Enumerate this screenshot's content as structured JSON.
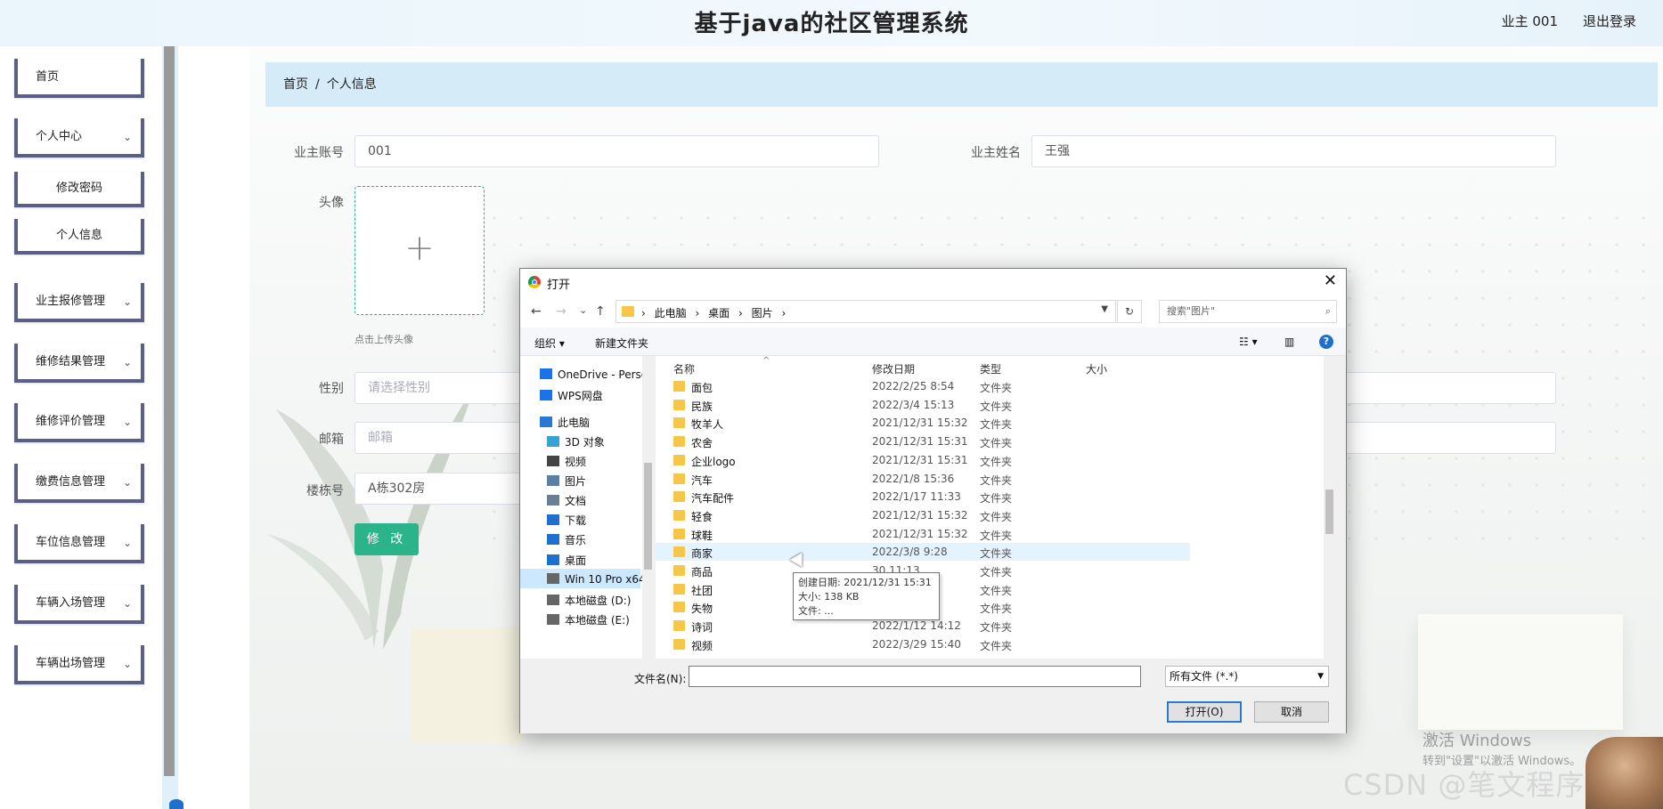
{
  "header": {
    "title": "基于java的社区管理系统",
    "user": "业主 001",
    "logout": "退出登录"
  },
  "sidebar": {
    "items": [
      {
        "label": "首页",
        "has_chevron": false
      },
      {
        "label": "个人中心",
        "has_chevron": true
      },
      {
        "label": "修改密码",
        "sub": true
      },
      {
        "label": "个人信息",
        "sub": true
      },
      {
        "label": "业主报修管理",
        "has_chevron": true
      },
      {
        "label": "维修结果管理",
        "has_chevron": true
      },
      {
        "label": "维修评价管理",
        "has_chevron": true
      },
      {
        "label": "缴费信息管理",
        "has_chevron": true
      },
      {
        "label": "车位信息管理",
        "has_chevron": true
      },
      {
        "label": "车辆入场管理",
        "has_chevron": true
      },
      {
        "label": "车辆出场管理",
        "has_chevron": true
      }
    ],
    "chevron": "⌄"
  },
  "breadcrumb": {
    "home": "首页",
    "sep": "/",
    "current": "个人信息"
  },
  "form": {
    "account_label": "业主账号",
    "account_value": "001",
    "name_label": "业主姓名",
    "name_value": "王强",
    "avatar_label": "头像",
    "avatar_hint": "点击上传头像",
    "avatar_plus": "+",
    "gender_label": "性别",
    "gender_placeholder": "请选择性别",
    "email_label": "邮箱",
    "email_placeholder": "邮箱",
    "building_label": "楼栋号",
    "building_value": "A栋302房",
    "submit_label": "修 改"
  },
  "dialog": {
    "title": "打开",
    "close": "✕",
    "nav": {
      "back": "←",
      "forward": "→",
      "recent": "⌄",
      "up": "↑",
      "refresh": "↻"
    },
    "path": [
      "此电脑",
      "桌面",
      "图片"
    ],
    "path_sep": "›",
    "search_placeholder": "搜索\"图片\"",
    "toolbar": {
      "organize": "组织 ▾",
      "new_folder": "新建文件夹",
      "help": "?"
    },
    "nav_pane": [
      {
        "label": "OneDrive - Perso",
        "icon": "cloud-icon"
      },
      {
        "label": "WPS网盘",
        "icon": "cloud-icon"
      },
      {
        "label": "此电脑",
        "icon": "computer-icon"
      },
      {
        "label": "3D 对象",
        "icon": "cube-icon"
      },
      {
        "label": "视频",
        "icon": "video-icon"
      },
      {
        "label": "图片",
        "icon": "picture-icon"
      },
      {
        "label": "文档",
        "icon": "document-icon"
      },
      {
        "label": "下载",
        "icon": "download-icon"
      },
      {
        "label": "音乐",
        "icon": "music-icon"
      },
      {
        "label": "桌面",
        "icon": "desktop-icon",
        "selected": true
      },
      {
        "label": "Win 10 Pro x64",
        "icon": "drive-icon"
      },
      {
        "label": "本地磁盘 (D:)",
        "icon": "drive-icon"
      },
      {
        "label": "本地磁盘 (E:)",
        "icon": "drive-icon"
      }
    ],
    "columns": {
      "name": "名称",
      "date": "修改日期",
      "type": "类型",
      "size": "大小"
    },
    "files": [
      {
        "name": "面包",
        "date": "2022/2/25 8:54",
        "type": "文件夹"
      },
      {
        "name": "民族",
        "date": "2022/3/4 15:13",
        "type": "文件夹"
      },
      {
        "name": "牧羊人",
        "date": "2021/12/31 15:32",
        "type": "文件夹"
      },
      {
        "name": "农舍",
        "date": "2021/12/31 15:31",
        "type": "文件夹"
      },
      {
        "name": "企业logo",
        "date": "2021/12/31 15:31",
        "type": "文件夹"
      },
      {
        "name": "汽车",
        "date": "2022/1/8 15:36",
        "type": "文件夹"
      },
      {
        "name": "汽车配件",
        "date": "2022/1/17 11:33",
        "type": "文件夹"
      },
      {
        "name": "轻食",
        "date": "2021/12/31 15:32",
        "type": "文件夹"
      },
      {
        "name": "球鞋",
        "date": "2021/12/31 15:32",
        "type": "文件夹"
      },
      {
        "name": "商家",
        "date": "2022/3/8 9:28",
        "type": "文件夹",
        "highlight": true
      },
      {
        "name": "商品",
        "date": "30 11:13",
        "type": "文件夹"
      },
      {
        "name": "社团",
        "date": "2/31 15:32",
        "type": "文件夹"
      },
      {
        "name": "失物",
        "date": "2/31 15:32",
        "type": "文件夹"
      },
      {
        "name": "诗词",
        "date": "2022/1/12 14:12",
        "type": "文件夹"
      },
      {
        "name": "视频",
        "date": "2022/3/29 15:40",
        "type": "文件夹"
      }
    ],
    "tooltip": {
      "line1": "创建日期: 2021/12/31 15:31",
      "line2": "大小: 138 KB",
      "line3": "文件: ..."
    },
    "filename_label": "文件名(N):",
    "filename_value": "",
    "filetype": "所有文件 (*.*)",
    "open_label": "打开(O)",
    "cancel_label": "取消"
  },
  "watermark": {
    "activate_title": "激活 Windows",
    "activate_sub": "转到\"设置\"以激活 Windows。",
    "csdn": "CSDN @笔文程序设计"
  }
}
